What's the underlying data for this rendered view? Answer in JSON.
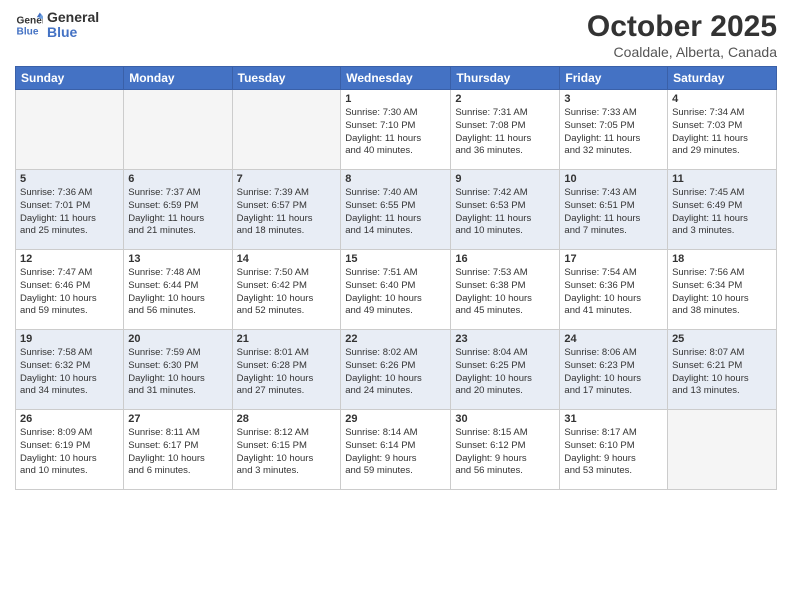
{
  "header": {
    "logo_general": "General",
    "logo_blue": "Blue",
    "month_title": "October 2025",
    "location": "Coaldale, Alberta, Canada"
  },
  "days_of_week": [
    "Sunday",
    "Monday",
    "Tuesday",
    "Wednesday",
    "Thursday",
    "Friday",
    "Saturday"
  ],
  "weeks": [
    [
      {
        "day": "",
        "info": []
      },
      {
        "day": "",
        "info": []
      },
      {
        "day": "",
        "info": []
      },
      {
        "day": "1",
        "info": [
          "Sunrise: 7:30 AM",
          "Sunset: 7:10 PM",
          "Daylight: 11 hours",
          "and 40 minutes."
        ]
      },
      {
        "day": "2",
        "info": [
          "Sunrise: 7:31 AM",
          "Sunset: 7:08 PM",
          "Daylight: 11 hours",
          "and 36 minutes."
        ]
      },
      {
        "day": "3",
        "info": [
          "Sunrise: 7:33 AM",
          "Sunset: 7:05 PM",
          "Daylight: 11 hours",
          "and 32 minutes."
        ]
      },
      {
        "day": "4",
        "info": [
          "Sunrise: 7:34 AM",
          "Sunset: 7:03 PM",
          "Daylight: 11 hours",
          "and 29 minutes."
        ]
      }
    ],
    [
      {
        "day": "5",
        "info": [
          "Sunrise: 7:36 AM",
          "Sunset: 7:01 PM",
          "Daylight: 11 hours",
          "and 25 minutes."
        ]
      },
      {
        "day": "6",
        "info": [
          "Sunrise: 7:37 AM",
          "Sunset: 6:59 PM",
          "Daylight: 11 hours",
          "and 21 minutes."
        ]
      },
      {
        "day": "7",
        "info": [
          "Sunrise: 7:39 AM",
          "Sunset: 6:57 PM",
          "Daylight: 11 hours",
          "and 18 minutes."
        ]
      },
      {
        "day": "8",
        "info": [
          "Sunrise: 7:40 AM",
          "Sunset: 6:55 PM",
          "Daylight: 11 hours",
          "and 14 minutes."
        ]
      },
      {
        "day": "9",
        "info": [
          "Sunrise: 7:42 AM",
          "Sunset: 6:53 PM",
          "Daylight: 11 hours",
          "and 10 minutes."
        ]
      },
      {
        "day": "10",
        "info": [
          "Sunrise: 7:43 AM",
          "Sunset: 6:51 PM",
          "Daylight: 11 hours",
          "and 7 minutes."
        ]
      },
      {
        "day": "11",
        "info": [
          "Sunrise: 7:45 AM",
          "Sunset: 6:49 PM",
          "Daylight: 11 hours",
          "and 3 minutes."
        ]
      }
    ],
    [
      {
        "day": "12",
        "info": [
          "Sunrise: 7:47 AM",
          "Sunset: 6:46 PM",
          "Daylight: 10 hours",
          "and 59 minutes."
        ]
      },
      {
        "day": "13",
        "info": [
          "Sunrise: 7:48 AM",
          "Sunset: 6:44 PM",
          "Daylight: 10 hours",
          "and 56 minutes."
        ]
      },
      {
        "day": "14",
        "info": [
          "Sunrise: 7:50 AM",
          "Sunset: 6:42 PM",
          "Daylight: 10 hours",
          "and 52 minutes."
        ]
      },
      {
        "day": "15",
        "info": [
          "Sunrise: 7:51 AM",
          "Sunset: 6:40 PM",
          "Daylight: 10 hours",
          "and 49 minutes."
        ]
      },
      {
        "day": "16",
        "info": [
          "Sunrise: 7:53 AM",
          "Sunset: 6:38 PM",
          "Daylight: 10 hours",
          "and 45 minutes."
        ]
      },
      {
        "day": "17",
        "info": [
          "Sunrise: 7:54 AM",
          "Sunset: 6:36 PM",
          "Daylight: 10 hours",
          "and 41 minutes."
        ]
      },
      {
        "day": "18",
        "info": [
          "Sunrise: 7:56 AM",
          "Sunset: 6:34 PM",
          "Daylight: 10 hours",
          "and 38 minutes."
        ]
      }
    ],
    [
      {
        "day": "19",
        "info": [
          "Sunrise: 7:58 AM",
          "Sunset: 6:32 PM",
          "Daylight: 10 hours",
          "and 34 minutes."
        ]
      },
      {
        "day": "20",
        "info": [
          "Sunrise: 7:59 AM",
          "Sunset: 6:30 PM",
          "Daylight: 10 hours",
          "and 31 minutes."
        ]
      },
      {
        "day": "21",
        "info": [
          "Sunrise: 8:01 AM",
          "Sunset: 6:28 PM",
          "Daylight: 10 hours",
          "and 27 minutes."
        ]
      },
      {
        "day": "22",
        "info": [
          "Sunrise: 8:02 AM",
          "Sunset: 6:26 PM",
          "Daylight: 10 hours",
          "and 24 minutes."
        ]
      },
      {
        "day": "23",
        "info": [
          "Sunrise: 8:04 AM",
          "Sunset: 6:25 PM",
          "Daylight: 10 hours",
          "and 20 minutes."
        ]
      },
      {
        "day": "24",
        "info": [
          "Sunrise: 8:06 AM",
          "Sunset: 6:23 PM",
          "Daylight: 10 hours",
          "and 17 minutes."
        ]
      },
      {
        "day": "25",
        "info": [
          "Sunrise: 8:07 AM",
          "Sunset: 6:21 PM",
          "Daylight: 10 hours",
          "and 13 minutes."
        ]
      }
    ],
    [
      {
        "day": "26",
        "info": [
          "Sunrise: 8:09 AM",
          "Sunset: 6:19 PM",
          "Daylight: 10 hours",
          "and 10 minutes."
        ]
      },
      {
        "day": "27",
        "info": [
          "Sunrise: 8:11 AM",
          "Sunset: 6:17 PM",
          "Daylight: 10 hours",
          "and 6 minutes."
        ]
      },
      {
        "day": "28",
        "info": [
          "Sunrise: 8:12 AM",
          "Sunset: 6:15 PM",
          "Daylight: 10 hours",
          "and 3 minutes."
        ]
      },
      {
        "day": "29",
        "info": [
          "Sunrise: 8:14 AM",
          "Sunset: 6:14 PM",
          "Daylight: 9 hours",
          "and 59 minutes."
        ]
      },
      {
        "day": "30",
        "info": [
          "Sunrise: 8:15 AM",
          "Sunset: 6:12 PM",
          "Daylight: 9 hours",
          "and 56 minutes."
        ]
      },
      {
        "day": "31",
        "info": [
          "Sunrise: 8:17 AM",
          "Sunset: 6:10 PM",
          "Daylight: 9 hours",
          "and 53 minutes."
        ]
      },
      {
        "day": "",
        "info": []
      }
    ]
  ]
}
